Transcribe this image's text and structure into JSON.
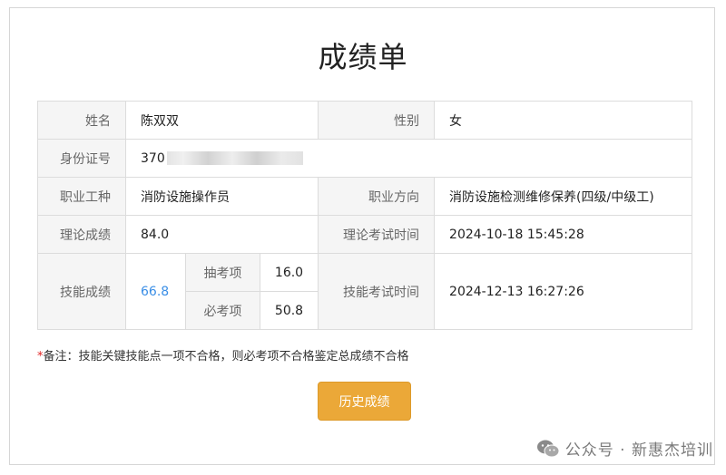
{
  "page_title": "成绩单",
  "table": {
    "name_label": "姓名",
    "name_value": "陈双双",
    "gender_label": "性别",
    "gender_value": "女",
    "id_label": "身份证号",
    "id_value_prefix": "370",
    "occupation_label": "职业工种",
    "occupation_value": "消防设施操作员",
    "direction_label": "职业方向",
    "direction_value": "消防设施检测维修保养(四级/中级工)",
    "theory_label": "理论成绩",
    "theory_value": "84.0",
    "theory_time_label": "理论考试时间",
    "theory_time_value": "2024-10-18 15:45:28",
    "skill_label": "技能成绩",
    "skill_value": "66.8",
    "random_label": "抽考项",
    "random_value": "16.0",
    "required_label": "必考项",
    "required_value": "50.8",
    "skill_time_label": "技能考试时间",
    "skill_time_value": "2024-12-13 16:27:26"
  },
  "note": {
    "star": "*",
    "text": "备注：技能关键技能点一项不合格，则必考项不合格鉴定总成绩不合格"
  },
  "history_button": "历史成绩",
  "watermark": "公众号 · 新惠杰培训",
  "colors": {
    "accent_button": "#eba838",
    "skill_score": "#3a8ee6",
    "note_star": "#e02020"
  }
}
